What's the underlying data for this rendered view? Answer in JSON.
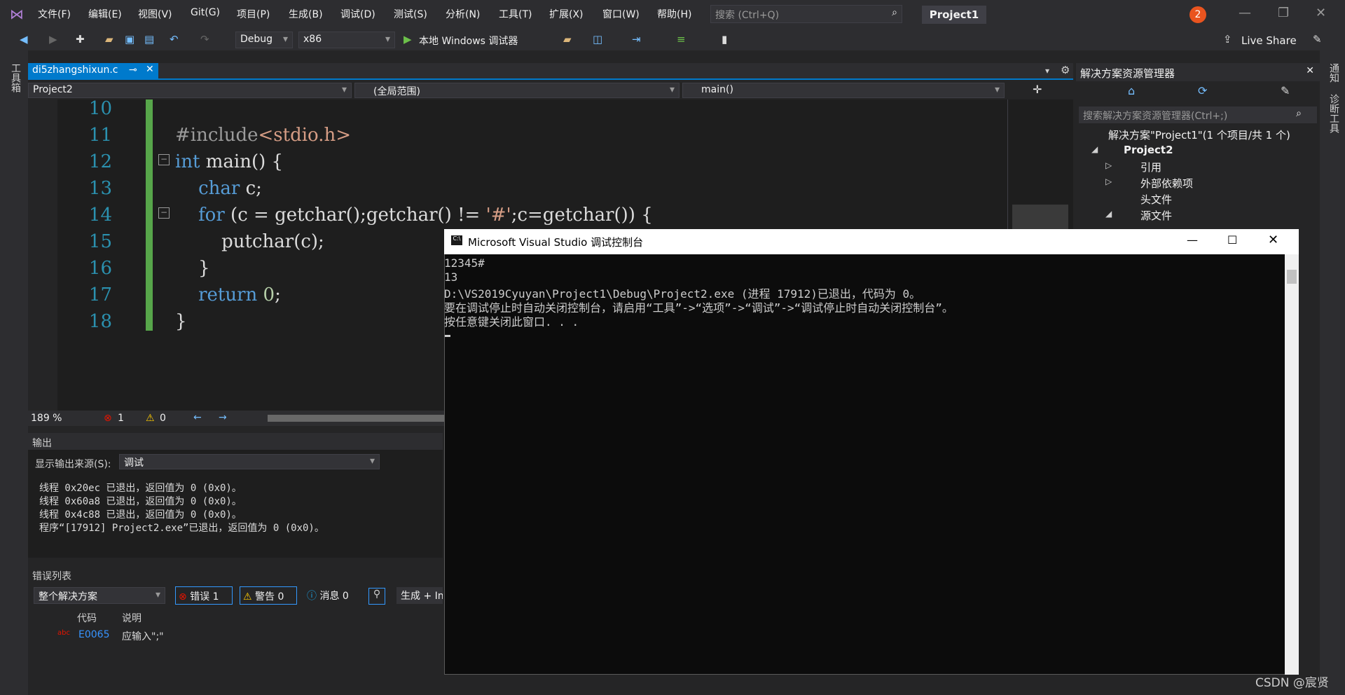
{
  "titlebar": {
    "menus": [
      "文件(F)",
      "编辑(E)",
      "视图(V)",
      "Git(G)",
      "项目(P)",
      "生成(B)",
      "调试(D)",
      "测试(S)",
      "分析(N)",
      "工具(T)",
      "扩展(X)",
      "窗口(W)",
      "帮助(H)"
    ],
    "search_placeholder": "搜索 (Ctrl+Q)",
    "project_name": "Project1",
    "notification_count": "2"
  },
  "toolbar": {
    "config": "Debug",
    "platform": "x86",
    "run_label": "本地 Windows 调试器",
    "live_share": "Live Share"
  },
  "left_strip": {
    "label": "工具箱"
  },
  "editor": {
    "tab_name": "di5zhangshixun.c",
    "nav_project": "Project2",
    "nav_scope": "(全局范围)",
    "nav_function": "main()",
    "lines": [
      "10",
      "11",
      "12",
      "13",
      "14",
      "15",
      "16",
      "17",
      "18"
    ],
    "zoom": "189 %",
    "errors": "1",
    "warnings": "0"
  },
  "output": {
    "title": "输出",
    "source_label": "显示输出来源(S):",
    "source_value": "调试",
    "lines": [
      "线程 0x20ec 已退出，返回值为 0 (0x0)。",
      "线程 0x60a8 已退出，返回值为 0 (0x0)。",
      "线程 0x4c88 已退出，返回值为 0 (0x0)。",
      "程序“[17912] Project2.exe”已退出，返回值为 0 (0x0)。"
    ]
  },
  "error_list": {
    "title": "错误列表",
    "scope": "整个解决方案",
    "errors_btn": "错误 1",
    "warnings_btn": "警告 0",
    "messages_btn": "消息 0",
    "build_btn": "生成 + In",
    "col_code": "代码",
    "col_desc": "说明",
    "row_code": "E0065",
    "row_desc": "应输入\";\""
  },
  "solution_explorer": {
    "title": "解决方案资源管理器",
    "search_placeholder": "搜索解决方案资源管理器(Ctrl+;)",
    "solution": "解决方案\"Project1\"(1 个项目/共 1 个)",
    "project": "Project2",
    "items": [
      "引用",
      "外部依赖项",
      "头文件",
      "源文件"
    ]
  },
  "right_strip": {
    "labels": [
      "通知",
      "诊断工具"
    ]
  },
  "console": {
    "title": "Microsoft Visual Studio 调试控制台",
    "lines": [
      "12345#",
      "13",
      "D:\\VS2019Cyuyan\\Project1\\Debug\\Project2.exe (进程 17912)已退出，代码为 0。",
      "要在调试停止时自动关闭控制台，请启用“工具”->“选项”->“调试”->“调试停止时自动关闭控制台”。",
      "按任意键关闭此窗口. . ."
    ]
  },
  "watermark": "CSDN @宸贤"
}
